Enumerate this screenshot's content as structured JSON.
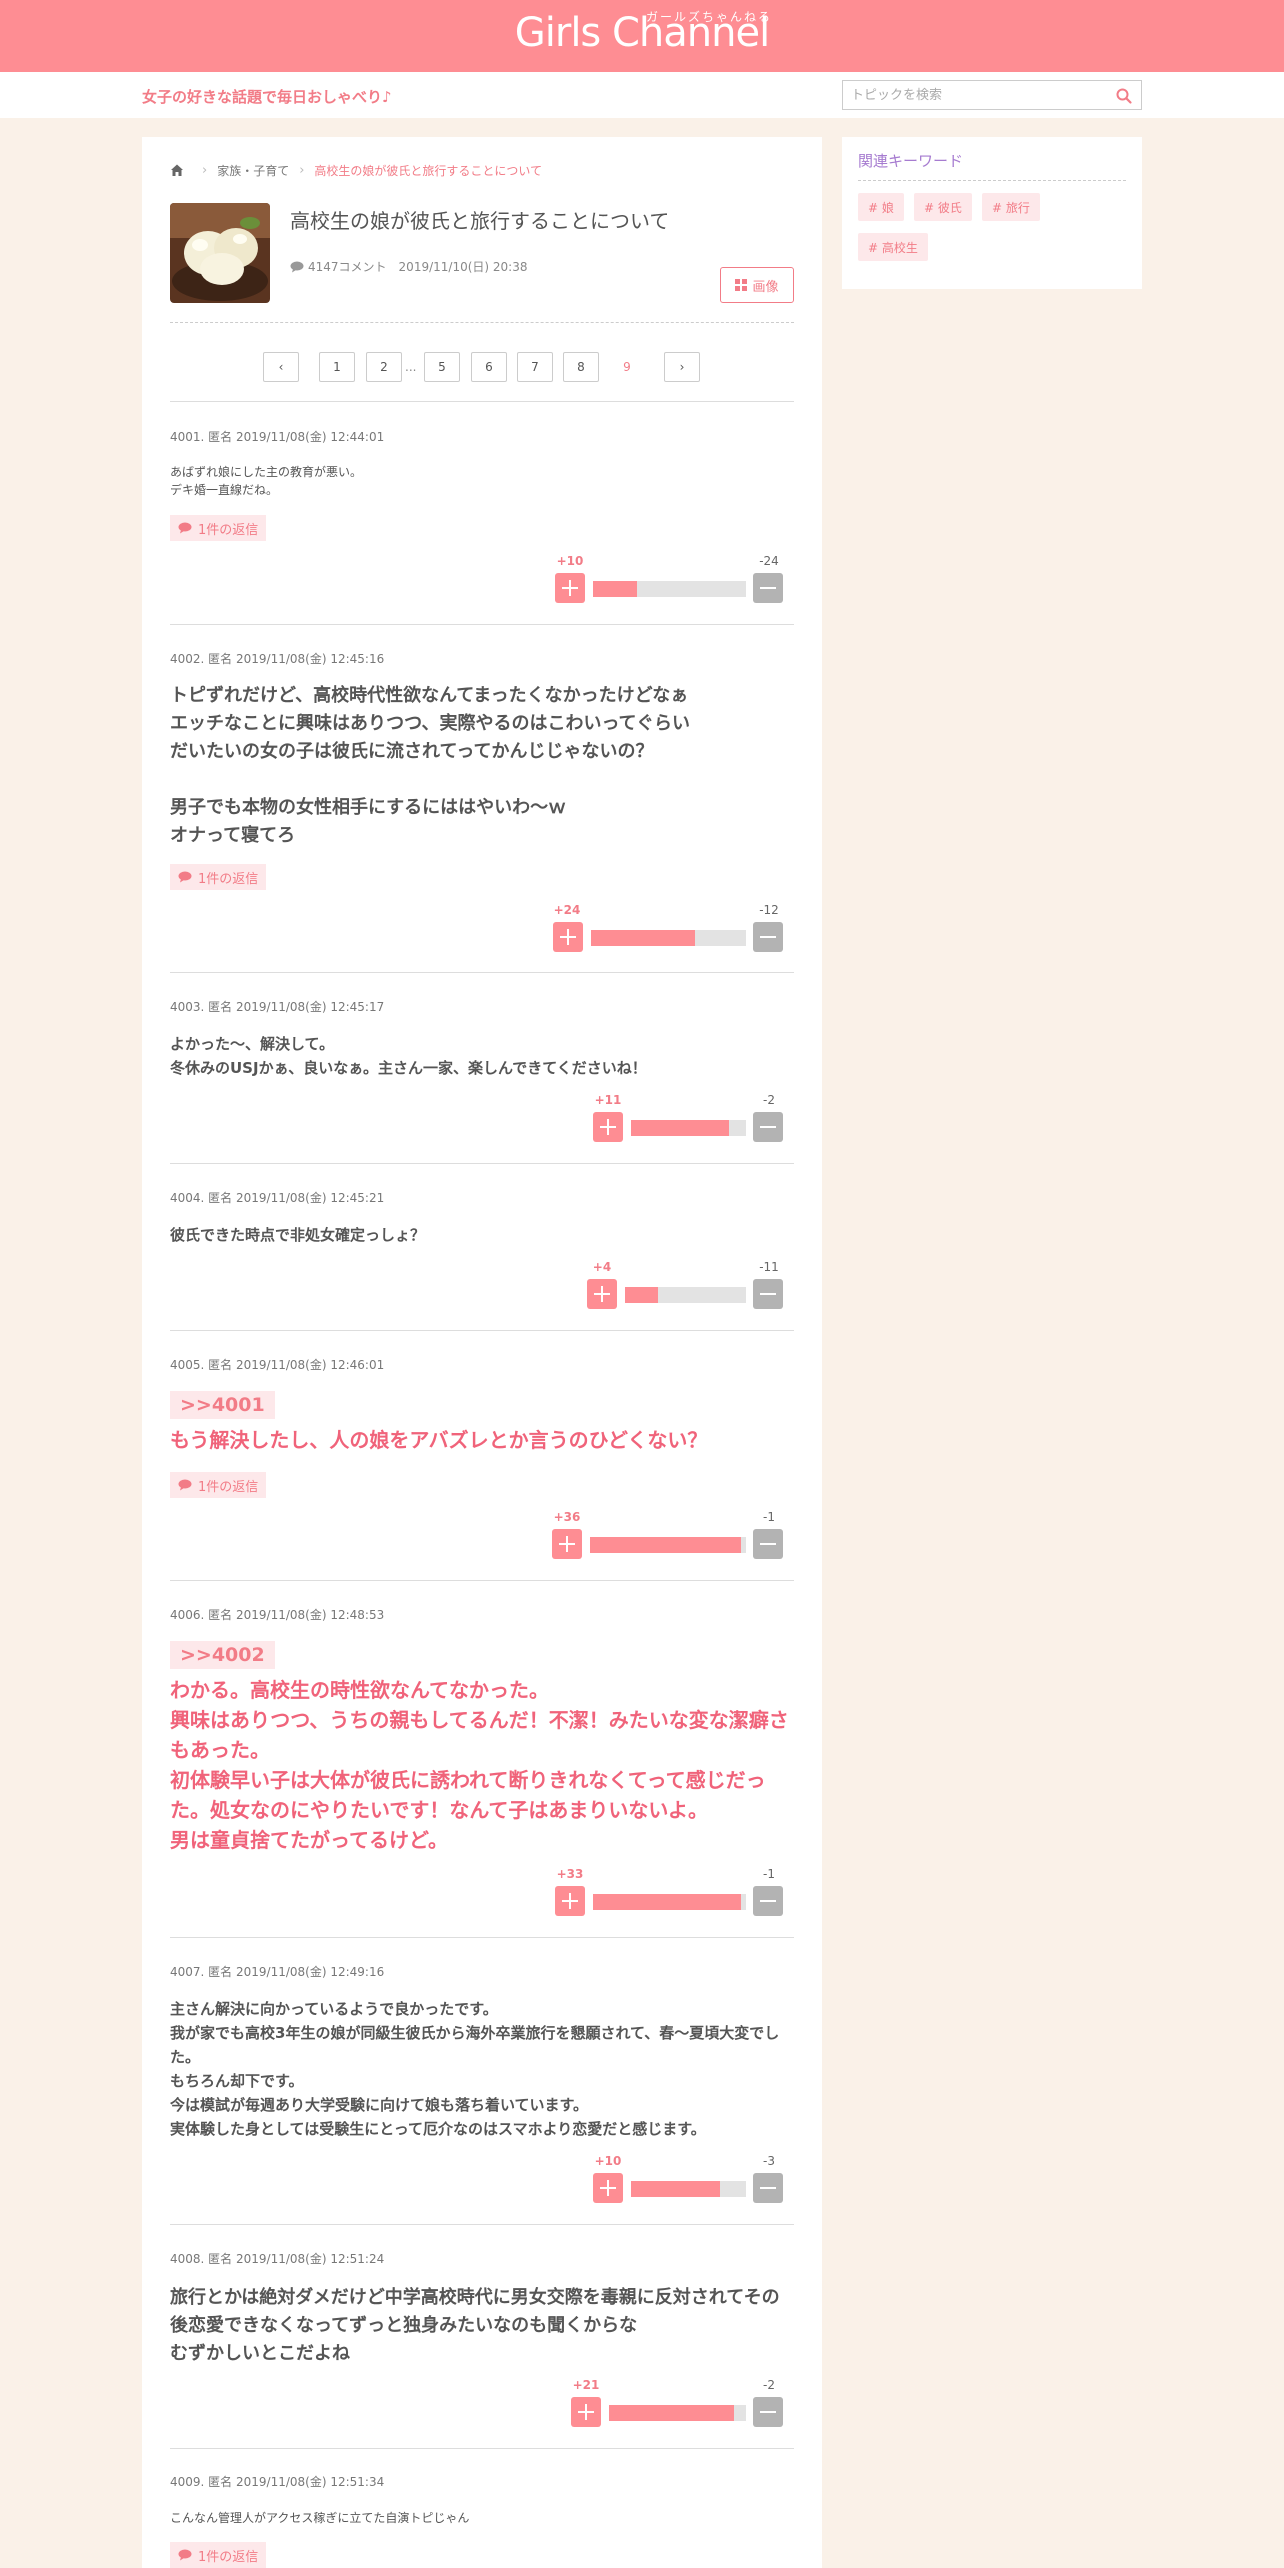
{
  "header": {
    "logo": "Girls Channel",
    "logo_kana": "ガールズちゃんねる",
    "tagline": "女子の好きな話題で毎日おしゃべり♪",
    "search_placeholder": "トピックを検索"
  },
  "breadcrumb": {
    "category": "家族・子育て",
    "current": "高校生の娘が彼氏と旅行することについて"
  },
  "topic": {
    "title": "高校生の娘が彼氏と旅行することについて",
    "comment_count": "4147コメント",
    "date": "2019/11/10(日) 20:38",
    "image_button": "画像"
  },
  "pager": {
    "prev": "‹",
    "next": "›",
    "pages": [
      "1",
      "2",
      "5",
      "6",
      "7",
      "8",
      "9"
    ],
    "dots": "...",
    "current": "9"
  },
  "comments": [
    {
      "header": "4001. 匿名 2019/11/08(金) 12:44:01",
      "body": "あばずれ娘にした主の教育が悪い。\nデキ婚一直線だね。",
      "reply": "1件の返信",
      "plus": "+10",
      "minus": "-24",
      "ratio": 0.29
    },
    {
      "header": "4002. 匿名 2019/11/08(金) 12:45:16",
      "body": "トピずれだけど、高校時代性欲なんてまったくなかったけどなぁ\nエッチなことに興味はありつつ、実際やるのはこわいってぐらい\nだいたいの女の子は彼氏に流されてってかんじじゃないの？\n\n男子でも本物の女性相手にするにははやいわ～ｗ\nオナって寝てろ",
      "reply": "1件の返信",
      "plus": "+24",
      "minus": "-12",
      "ratio": 0.67
    },
    {
      "header": "4003. 匿名 2019/11/08(金) 12:45:17",
      "body": "よかった〜、解決して。\n冬休みのUSJかぁ、良いなぁ。主さん一家、楽しんできてくださいね！",
      "plus": "+11",
      "minus": "-2",
      "ratio": 0.85
    },
    {
      "header": "4004. 匿名 2019/11/08(金) 12:45:21",
      "body": "彼氏できた時点で非処女確定っしょ？",
      "plus": "+4",
      "minus": "-11",
      "ratio": 0.27
    },
    {
      "header": "4005. 匿名 2019/11/08(金) 12:46:01",
      "anchor": ">>4001",
      "body": "もう解決したし、人の娘をアバズレとか言うのひどくない？",
      "reply": "1件の返信",
      "plus": "+36",
      "minus": "-1",
      "ratio": 0.97
    },
    {
      "header": "4006. 匿名 2019/11/08(金) 12:48:53",
      "anchor": ">>4002",
      "body": "わかる。高校生の時性欲なんてなかった。\n興味はありつつ、うちの親もしてるんだ！不潔！みたいな変な潔癖さもあった。\n初体験早い子は大体が彼氏に誘われて断りきれなくてって感じだった。処女なのにやりたいです！なんて子はあまりいないよ。\n男は童貞捨てたがってるけど。",
      "plus": "+33",
      "minus": "-1",
      "ratio": 0.97
    },
    {
      "header": "4007. 匿名 2019/11/08(金) 12:49:16",
      "body": "主さん解決に向かっているようで良かったです。\n我が家でも高校3年生の娘が同級生彼氏から海外卒業旅行を懇願されて、春～夏頃大変でした。\nもちろん却下です。\n今は模試が毎週あり大学受験に向けて娘も落ち着いています。\n実体験した身としては受験生にとって厄介なのはスマホより恋愛だと感じます。",
      "plus": "+10",
      "minus": "-3",
      "ratio": 0.77
    },
    {
      "header": "4008. 匿名 2019/11/08(金) 12:51:24",
      "body": "旅行とかは絶対ダメだけど中学高校時代に男女交際を毒親に反対されてその後恋愛できなくなってずっと独身みたいなのも聞くからな\nむずかしいとこだよね",
      "plus": "+21",
      "minus": "-2",
      "ratio": 0.91
    },
    {
      "header": "4009. 匿名 2019/11/08(金) 12:51:34",
      "body": "こんなん管理人がアクセス稼ぎに立てた自演トピじゃん",
      "reply": "1件の返信"
    }
  ],
  "sidebar": {
    "title": "関連キーワード",
    "keywords": [
      "# 娘",
      "# 彼氏",
      "# 旅行",
      "# 高校生"
    ]
  },
  "colors": {
    "brand": "#fe8d93",
    "accent_text": "#f27c87",
    "background": "#faf1e8",
    "keyword_title": "#a67bd0"
  }
}
